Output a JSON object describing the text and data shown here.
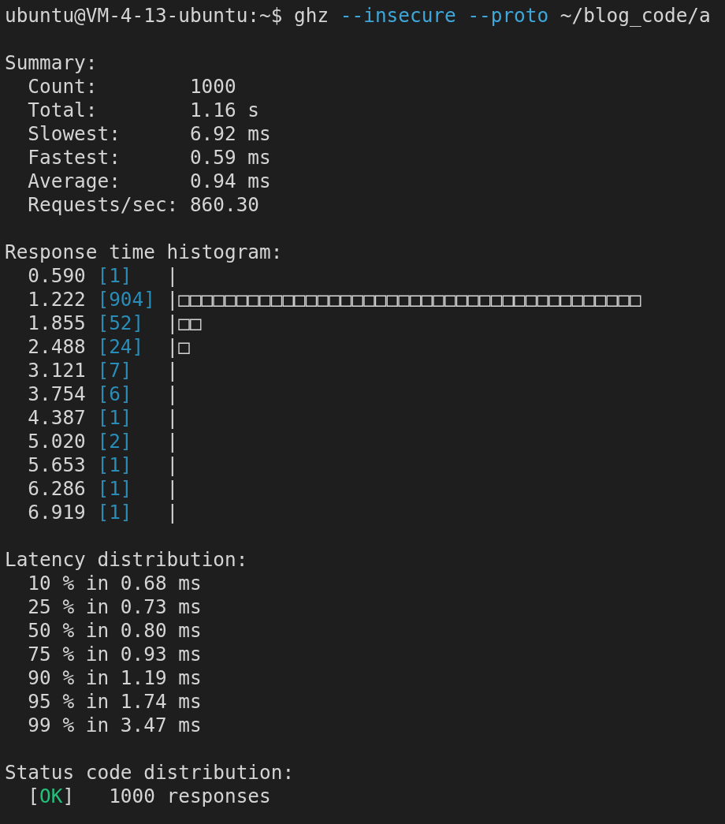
{
  "command": {
    "prompt": "ubuntu@VM-4-13-ubuntu:~$",
    "program": "ghz",
    "args": [
      {
        "text": "--insecure",
        "kind": "flag"
      },
      {
        "text": "--proto",
        "kind": "flag"
      },
      {
        "text": "~/blog_code/a",
        "kind": "path"
      }
    ]
  },
  "summary": {
    "title": "Summary:",
    "rows": [
      {
        "label": "Count:",
        "value": "1000"
      },
      {
        "label": "Total:",
        "value": "1.16 s"
      },
      {
        "label": "Slowest:",
        "value": "6.92 ms"
      },
      {
        "label": "Fastest:",
        "value": "0.59 ms"
      },
      {
        "label": "Average:",
        "value": "0.94 ms"
      },
      {
        "label": "Requests/sec:",
        "value": "860.30"
      }
    ]
  },
  "histogram": {
    "title": "Response time histogram:",
    "rows": [
      {
        "mark": "0.590",
        "count": "[1]",
        "bar": "|"
      },
      {
        "mark": "1.222",
        "count": "[904]",
        "bar": "|□□□□□□□□□□□□□□□□□□□□□□□□□□□□□□□□□□□□□□□□"
      },
      {
        "mark": "1.855",
        "count": "[52]",
        "bar": "|□□"
      },
      {
        "mark": "2.488",
        "count": "[24]",
        "bar": "|□"
      },
      {
        "mark": "3.121",
        "count": "[7]",
        "bar": "|"
      },
      {
        "mark": "3.754",
        "count": "[6]",
        "bar": "|"
      },
      {
        "mark": "4.387",
        "count": "[1]",
        "bar": "|"
      },
      {
        "mark": "5.020",
        "count": "[2]",
        "bar": "|"
      },
      {
        "mark": "5.653",
        "count": "[1]",
        "bar": "|"
      },
      {
        "mark": "6.286",
        "count": "[1]",
        "bar": "|"
      },
      {
        "mark": "6.919",
        "count": "[1]",
        "bar": "|"
      }
    ]
  },
  "latency": {
    "title": "Latency distribution:",
    "rows": [
      "10 % in 0.68 ms",
      "25 % in 0.73 ms",
      "50 % in 0.80 ms",
      "75 % in 0.93 ms",
      "90 % in 1.19 ms",
      "95 % in 1.74 ms",
      "99 % in 3.47 ms"
    ]
  },
  "status": {
    "title": "Status code distribution:",
    "rows": [
      {
        "code": "[OK]",
        "text": "1000 responses"
      }
    ]
  }
}
